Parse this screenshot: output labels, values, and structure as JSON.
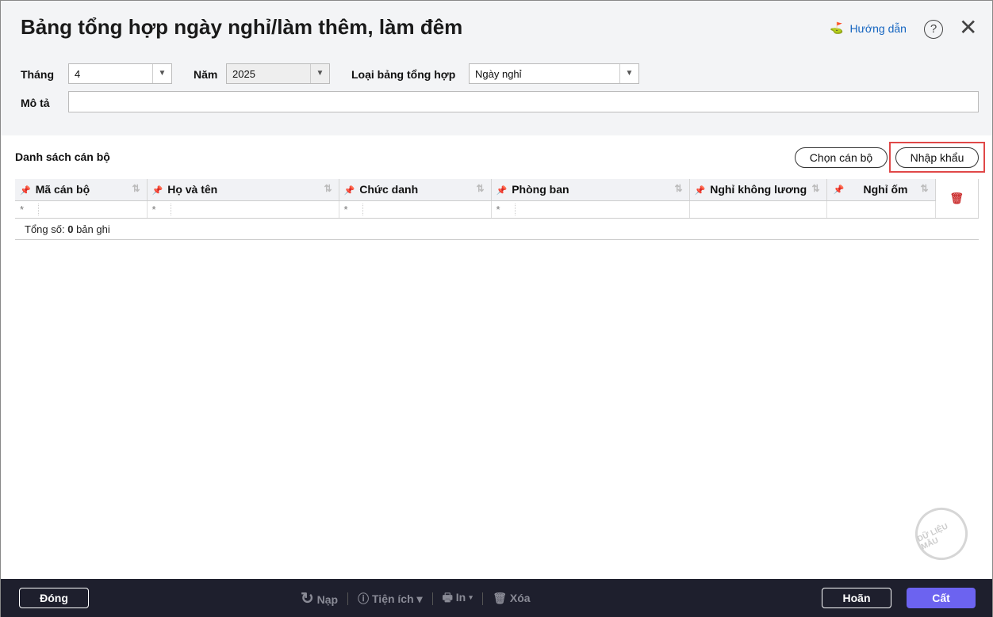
{
  "header": {
    "title": "Bảng tổng hợp ngày nghỉ/làm thêm, làm đêm",
    "help": "Hướng dẫn"
  },
  "form": {
    "month_label": "Tháng",
    "month": "4",
    "year_label": "Năm",
    "year": "2025",
    "type_label": "Loại bảng tổng hợp",
    "type": "Ngày nghỉ",
    "desc_label": "Mô tả",
    "desc": ""
  },
  "list": {
    "title": "Danh sách cán bộ",
    "choose": "Chọn cán bộ",
    "import": "Nhập khẩu",
    "columns": [
      "Mã cán bộ",
      "Họ và tên",
      "Chức danh",
      "Phòng ban",
      "Nghỉ không lương",
      "Nghỉ ốm"
    ],
    "filter": "*",
    "total_prefix": "Tổng số:",
    "total": "0",
    "total_suffix": "bản ghi"
  },
  "watermark": "DỮ LIỆU MẪU",
  "footer": {
    "close": "Đóng",
    "reload": "Nạp",
    "utils": "Tiện ích",
    "print": "In",
    "delete": "Xóa",
    "cancel": "Hoãn",
    "save": "Cất"
  },
  "colors": {
    "accent": "#6c63f0",
    "highlight": "#e04848",
    "footer": "#1e1f2d"
  }
}
